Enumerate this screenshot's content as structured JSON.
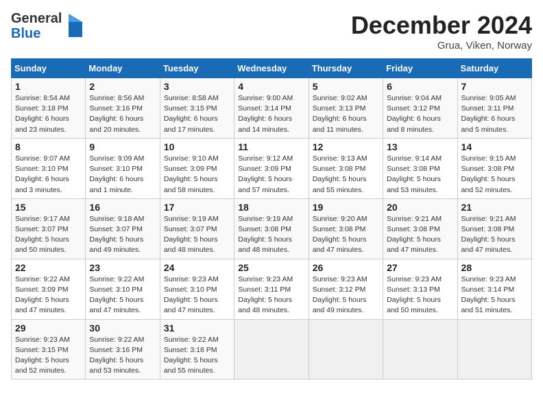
{
  "header": {
    "logo_line1": "General",
    "logo_line2": "Blue",
    "month_year": "December 2024",
    "location": "Grua, Viken, Norway"
  },
  "days_of_week": [
    "Sunday",
    "Monday",
    "Tuesday",
    "Wednesday",
    "Thursday",
    "Friday",
    "Saturday"
  ],
  "weeks": [
    [
      {
        "day": 1,
        "sunrise": "8:54 AM",
        "sunset": "3:18 PM",
        "daylight": "6 hours and 23 minutes."
      },
      {
        "day": 2,
        "sunrise": "8:56 AM",
        "sunset": "3:16 PM",
        "daylight": "6 hours and 20 minutes."
      },
      {
        "day": 3,
        "sunrise": "8:58 AM",
        "sunset": "3:15 PM",
        "daylight": "6 hours and 17 minutes."
      },
      {
        "day": 4,
        "sunrise": "9:00 AM",
        "sunset": "3:14 PM",
        "daylight": "6 hours and 14 minutes."
      },
      {
        "day": 5,
        "sunrise": "9:02 AM",
        "sunset": "3:13 PM",
        "daylight": "6 hours and 11 minutes."
      },
      {
        "day": 6,
        "sunrise": "9:04 AM",
        "sunset": "3:12 PM",
        "daylight": "6 hours and 8 minutes."
      },
      {
        "day": 7,
        "sunrise": "9:05 AM",
        "sunset": "3:11 PM",
        "daylight": "6 hours and 5 minutes."
      }
    ],
    [
      {
        "day": 8,
        "sunrise": "9:07 AM",
        "sunset": "3:10 PM",
        "daylight": "6 hours and 3 minutes."
      },
      {
        "day": 9,
        "sunrise": "9:09 AM",
        "sunset": "3:10 PM",
        "daylight": "6 hours and 1 minute."
      },
      {
        "day": 10,
        "sunrise": "9:10 AM",
        "sunset": "3:09 PM",
        "daylight": "5 hours and 58 minutes."
      },
      {
        "day": 11,
        "sunrise": "9:12 AM",
        "sunset": "3:09 PM",
        "daylight": "5 hours and 57 minutes."
      },
      {
        "day": 12,
        "sunrise": "9:13 AM",
        "sunset": "3:08 PM",
        "daylight": "5 hours and 55 minutes."
      },
      {
        "day": 13,
        "sunrise": "9:14 AM",
        "sunset": "3:08 PM",
        "daylight": "5 hours and 53 minutes."
      },
      {
        "day": 14,
        "sunrise": "9:15 AM",
        "sunset": "3:08 PM",
        "daylight": "5 hours and 52 minutes."
      }
    ],
    [
      {
        "day": 15,
        "sunrise": "9:17 AM",
        "sunset": "3:07 PM",
        "daylight": "5 hours and 50 minutes."
      },
      {
        "day": 16,
        "sunrise": "9:18 AM",
        "sunset": "3:07 PM",
        "daylight": "5 hours and 49 minutes."
      },
      {
        "day": 17,
        "sunrise": "9:19 AM",
        "sunset": "3:07 PM",
        "daylight": "5 hours and 48 minutes."
      },
      {
        "day": 18,
        "sunrise": "9:19 AM",
        "sunset": "3:08 PM",
        "daylight": "5 hours and 48 minutes."
      },
      {
        "day": 19,
        "sunrise": "9:20 AM",
        "sunset": "3:08 PM",
        "daylight": "5 hours and 47 minutes."
      },
      {
        "day": 20,
        "sunrise": "9:21 AM",
        "sunset": "3:08 PM",
        "daylight": "5 hours and 47 minutes."
      },
      {
        "day": 21,
        "sunrise": "9:21 AM",
        "sunset": "3:08 PM",
        "daylight": "5 hours and 47 minutes."
      }
    ],
    [
      {
        "day": 22,
        "sunrise": "9:22 AM",
        "sunset": "3:09 PM",
        "daylight": "5 hours and 47 minutes."
      },
      {
        "day": 23,
        "sunrise": "9:22 AM",
        "sunset": "3:10 PM",
        "daylight": "5 hours and 47 minutes."
      },
      {
        "day": 24,
        "sunrise": "9:23 AM",
        "sunset": "3:10 PM",
        "daylight": "5 hours and 47 minutes."
      },
      {
        "day": 25,
        "sunrise": "9:23 AM",
        "sunset": "3:11 PM",
        "daylight": "5 hours and 48 minutes."
      },
      {
        "day": 26,
        "sunrise": "9:23 AM",
        "sunset": "3:12 PM",
        "daylight": "5 hours and 49 minutes."
      },
      {
        "day": 27,
        "sunrise": "9:23 AM",
        "sunset": "3:13 PM",
        "daylight": "5 hours and 50 minutes."
      },
      {
        "day": 28,
        "sunrise": "9:23 AM",
        "sunset": "3:14 PM",
        "daylight": "5 hours and 51 minutes."
      }
    ],
    [
      {
        "day": 29,
        "sunrise": "9:23 AM",
        "sunset": "3:15 PM",
        "daylight": "5 hours and 52 minutes."
      },
      {
        "day": 30,
        "sunrise": "9:22 AM",
        "sunset": "3:16 PM",
        "daylight": "5 hours and 53 minutes."
      },
      {
        "day": 31,
        "sunrise": "9:22 AM",
        "sunset": "3:18 PM",
        "daylight": "5 hours and 55 minutes."
      },
      null,
      null,
      null,
      null
    ]
  ],
  "labels": {
    "sunrise": "Sunrise:",
    "sunset": "Sunset:",
    "daylight": "Daylight:"
  }
}
